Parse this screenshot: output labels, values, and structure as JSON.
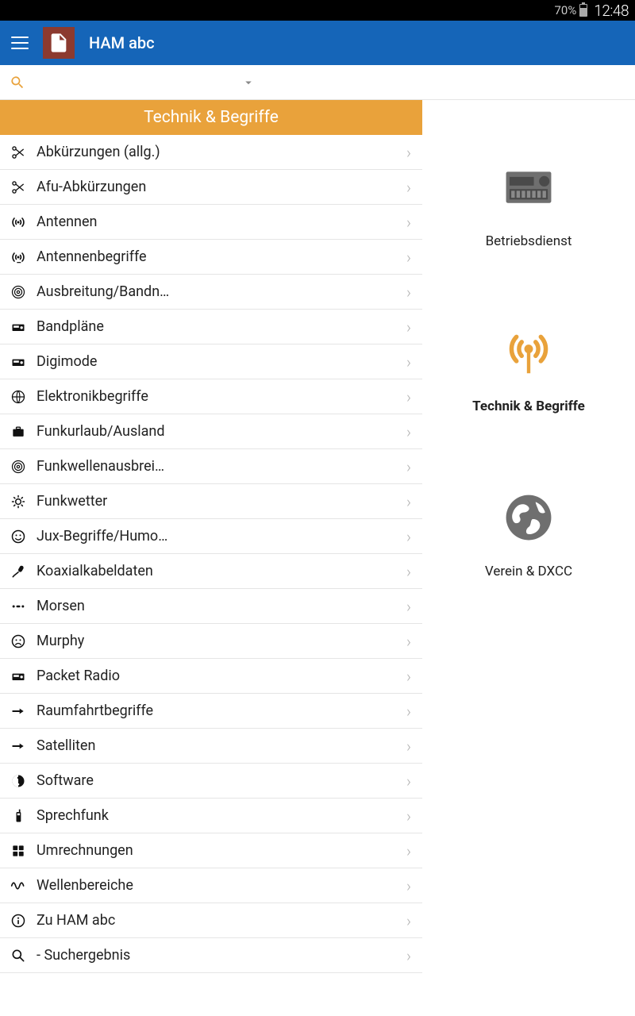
{
  "statusbar": {
    "battery_pct": "70%",
    "time": "12:48"
  },
  "app": {
    "title": "HAM abc"
  },
  "category_header": "Technik & Begriffe",
  "list": [
    {
      "label": "Abkürzungen (allg.)"
    },
    {
      "label": "Afu-Abkürzungen"
    },
    {
      "label": "Antennen"
    },
    {
      "label": "Antennenbegriffe"
    },
    {
      "label": "Ausbreitung/Bandn…"
    },
    {
      "label": "Bandpläne"
    },
    {
      "label": "Digimode"
    },
    {
      "label": "Elektronikbegriffe"
    },
    {
      "label": "Funkurlaub/Ausland"
    },
    {
      "label": "Funkwellenausbrei…"
    },
    {
      "label": "Funkwetter"
    },
    {
      "label": "Jux-Begriffe/Humo…"
    },
    {
      "label": "Koaxialkabeldaten"
    },
    {
      "label": "Morsen"
    },
    {
      "label": "Murphy"
    },
    {
      "label": "Packet Radio"
    },
    {
      "label": "Raumfahrtbegriffe"
    },
    {
      "label": "Satelliten"
    },
    {
      "label": "Software"
    },
    {
      "label": "Sprechfunk"
    },
    {
      "label": "Umrechnungen"
    },
    {
      "label": "Wellenbereiche"
    },
    {
      "label": "Zu HAM abc"
    },
    {
      "label": "- Suchergebnis"
    }
  ],
  "side": [
    {
      "label": "Betriebsdienst"
    },
    {
      "label": "Technik & Begriffe",
      "active": true
    },
    {
      "label": "Verein & DXCC"
    }
  ]
}
